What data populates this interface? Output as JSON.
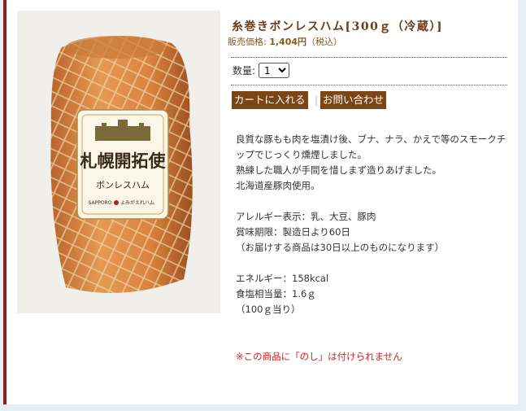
{
  "product": {
    "title": "糸巻きボンレスハム[300ｇ（冷蔵）]",
    "price_label": "販売価格:",
    "price_amount": "1,404円",
    "price_tax": "（税込）",
    "photo_label_main": "札幌開拓使",
    "photo_label_sub": "ボンレスハム",
    "photo_label_brand": "SAPPORO",
    "photo_label_maker": "よみがえれハム"
  },
  "quantity": {
    "label": "数量:",
    "selected": "1",
    "options": [
      "1"
    ]
  },
  "buttons": {
    "add_to_cart": "カートに入れる",
    "separator": "|",
    "inquiry": "お問い合わせ"
  },
  "description": {
    "lines_1": [
      "良質な豚もも肉を塩漬け後、ブナ、ナラ、かえで等のスモークチップでじっくり燻煙しました。",
      "熟練した職人が手間を惜しまず造りあげました。",
      "北海道産豚肉使用。"
    ],
    "lines_2": [
      "アレルギー表示：乳、大豆、豚肉",
      "賞味期限：製造日より60日",
      "（お届けする商品は30日以上のものになります）"
    ],
    "lines_3": [
      "エネルギー：158kcal",
      "食塩相当量：1.6ｇ",
      "（100ｇ当り）"
    ]
  },
  "notice": "※この商品に「のし」は付けられません",
  "colors": {
    "accent_bar": "#8b1e1e",
    "button_bg": "#7b4516",
    "title": "#6a3a1a",
    "price": "#8a5a1c",
    "notice": "#d42020",
    "page_bg": "#e6eef6"
  }
}
